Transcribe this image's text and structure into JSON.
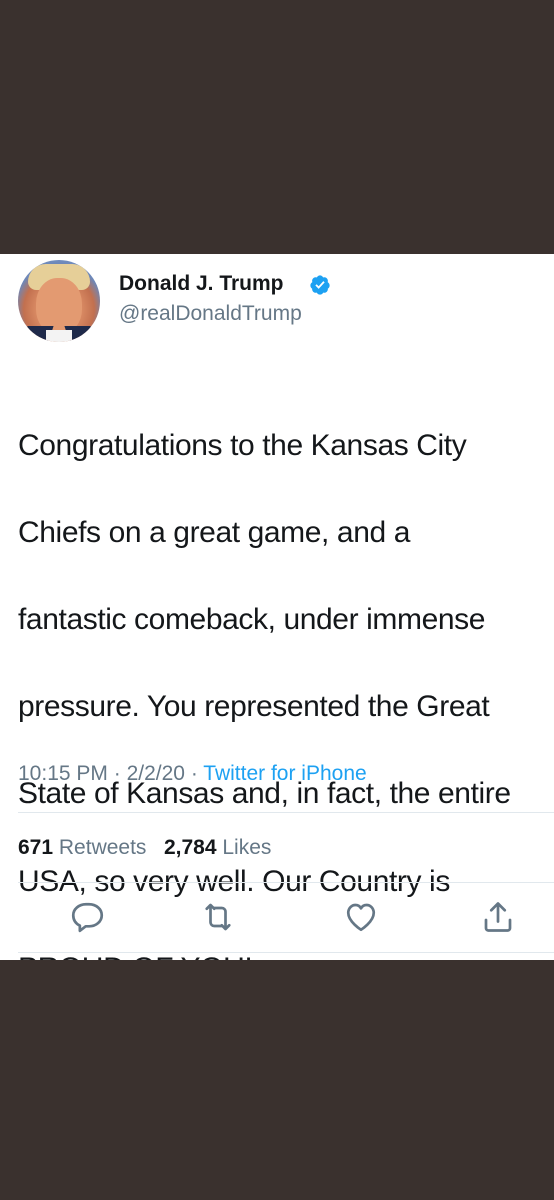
{
  "tweet": {
    "author": {
      "display_name": "Donald J. Trump",
      "handle": "@realDonaldTrump",
      "verified": true,
      "verified_icon": "verified-badge-icon",
      "verified_color": "#1da1f2"
    },
    "lines": [
      "Congratulations to the Kansas City",
      "Chiefs on a great game, and a",
      "fantastic comeback, under immense",
      "pressure. You represented the Great",
      "State of Kansas and, in fact, the entire",
      "USA, so very well. Our Country is",
      "PROUD OF YOU!"
    ],
    "time": "10:15 PM",
    "separator": "·",
    "date": "2/2/20",
    "source": "Twitter for iPhone",
    "retweets": {
      "count": "671",
      "label": "Retweets"
    },
    "likes": {
      "count": "2,784",
      "label": "Likes"
    }
  },
  "actions": [
    {
      "icon": "reply-icon"
    },
    {
      "icon": "retweet-icon"
    },
    {
      "icon": "like-icon"
    },
    {
      "icon": "share-icon"
    }
  ],
  "colors": {
    "background": "#3a312e",
    "card": "#ffffff",
    "text": "#14171a",
    "secondary": "#657786",
    "accent": "#1da1f2",
    "divider": "#e1e8ed"
  }
}
